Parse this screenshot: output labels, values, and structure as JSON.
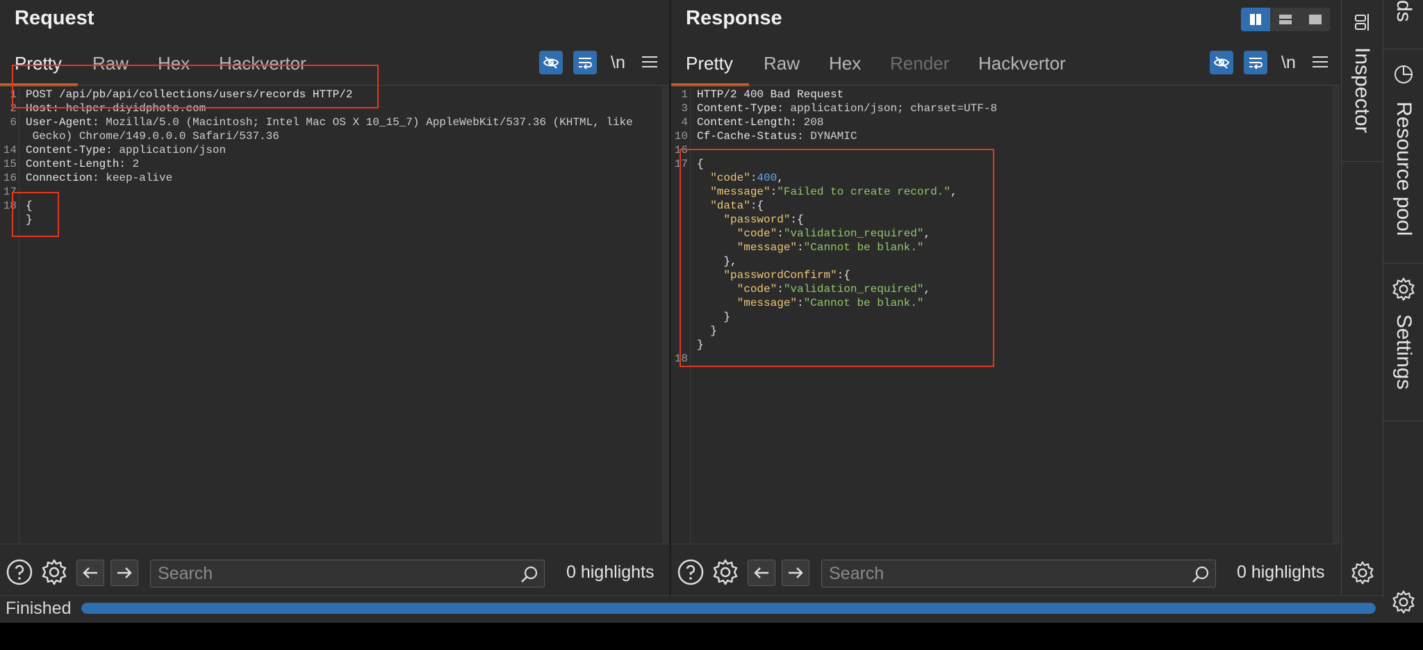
{
  "request": {
    "title": "Request",
    "tabs": [
      "Pretty",
      "Raw",
      "Hex",
      "Hackvertor"
    ],
    "newline_label": "\\n",
    "lines": [
      {
        "n": "1",
        "k": "POST /api/pb/api/collections/users/records HTTP/2",
        "v": ""
      },
      {
        "n": "2",
        "k": "Host: ",
        "v": "helper.diyidphoto.com"
      },
      {
        "n": "6",
        "k": "User-Agent: ",
        "v": "Mozilla/5.0 (Macintosh; Intel Mac OS X 10_15_7) AppleWebKit/537.36 (KHTML, like"
      },
      {
        "n": "",
        "k": "",
        "v": " Gecko) Chrome/149.0.0.0 Safari/537.36"
      },
      {
        "n": "14",
        "k": "Content-Type: ",
        "v": "application/json"
      },
      {
        "n": "15",
        "k": "Content-Length: ",
        "v": "2"
      },
      {
        "n": "16",
        "k": "Connection: ",
        "v": "keep-alive"
      },
      {
        "n": "17",
        "k": "",
        "v": ""
      },
      {
        "n": "18",
        "k": "{",
        "v": ""
      },
      {
        "n": "",
        "k": "}",
        "v": ""
      }
    ],
    "search_placeholder": "Search",
    "highlights": "0 highlights"
  },
  "response": {
    "title": "Response",
    "tabs": [
      "Pretty",
      "Raw",
      "Hex",
      "Render",
      "Hackvertor"
    ],
    "newline_label": "\\n",
    "header_lines": [
      {
        "n": "1",
        "k": "HTTP/2 400 Bad Request",
        "v": ""
      },
      {
        "n": "3",
        "k": "Content-Type: ",
        "v": "application/json; charset=UTF-8"
      },
      {
        "n": "4",
        "k": "Content-Length: ",
        "v": "208"
      },
      {
        "n": "10",
        "k": "Cf-Cache-Status: ",
        "v": "DYNAMIC"
      },
      {
        "n": "16",
        "k": "",
        "v": ""
      }
    ],
    "body_start_line": "17",
    "body_end_line": "18",
    "json": {
      "code_key": "\"code\"",
      "code_val": "400",
      "message_key": "\"message\"",
      "message_val": "\"Failed to create record.\"",
      "data_key": "\"data\"",
      "password_key": "\"password\"",
      "password_code_key": "\"code\"",
      "password_code_val": "\"validation_required\"",
      "password_message_key": "\"message\"",
      "password_message_val": "\"Cannot be blank.\"",
      "confirm_key": "\"passwordConfirm\"",
      "confirm_code_key": "\"code\"",
      "confirm_code_val": "\"validation_required\"",
      "confirm_message_key": "\"message\"",
      "confirm_message_val": "\"Cannot be blank.\""
    },
    "search_placeholder": "Search",
    "highlights": "0 highlights"
  },
  "sidebar": {
    "top_partial": "ds",
    "inspector": "Inspector",
    "resource_pool": "Resource pool",
    "settings": "Settings"
  },
  "status": {
    "text": "Finished",
    "progress_fraction": 1.0
  },
  "colors": {
    "accent": "#2f6fb0",
    "tab_underline": "#e8662a",
    "annotation": "#e0391f"
  }
}
